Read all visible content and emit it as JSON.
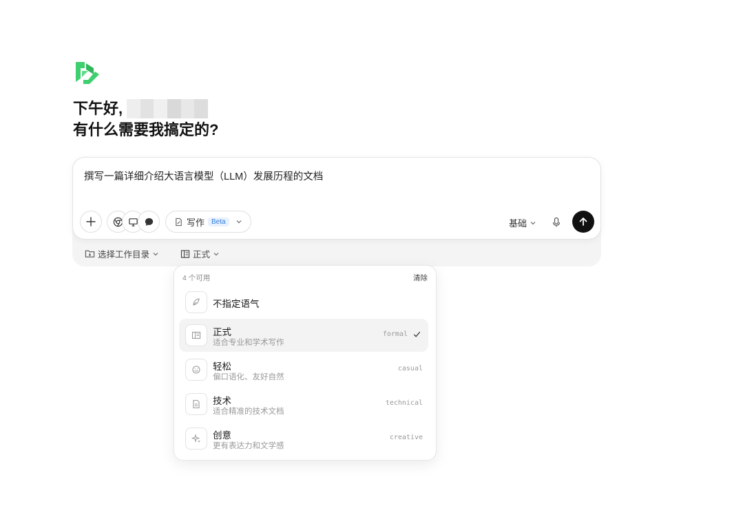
{
  "greeting": {
    "line1": "下午好,",
    "line2": "有什么需要我搞定的?"
  },
  "composer": {
    "prompt": "撰写一篇详细介绍大语言模型（LLM）发展历程的文档",
    "write_label": "写作",
    "beta_badge": "Beta",
    "mode": "基础"
  },
  "subbar": {
    "dir_label": "选择工作目录",
    "tone_label": "正式"
  },
  "dropdown": {
    "available": "4 个可用",
    "clear": "清除",
    "none_label": "不指定语气",
    "tones": [
      {
        "title": "正式",
        "desc": "适合专业和学术写作",
        "code": "formal",
        "selected": true
      },
      {
        "title": "轻松",
        "desc": "偏口语化、友好自然",
        "code": "casual"
      },
      {
        "title": "技术",
        "desc": "适合精准的技术文档",
        "code": "technical"
      },
      {
        "title": "创意",
        "desc": "更有表达力和文学感",
        "code": "creative"
      }
    ]
  },
  "colors": {
    "brand": "#3ecf6e",
    "send": "#111111",
    "beta": "#2f7de0"
  },
  "icons": [
    "logo",
    "plus-icon",
    "chrome-icon",
    "monitor-icon",
    "chat-icon",
    "write-icon",
    "chevron-down-icon",
    "mic-icon",
    "arrow-up-icon",
    "folder-icon",
    "layout-icon",
    "feather-icon",
    "smile-icon",
    "file-icon",
    "sparkle-icon",
    "check-icon"
  ]
}
